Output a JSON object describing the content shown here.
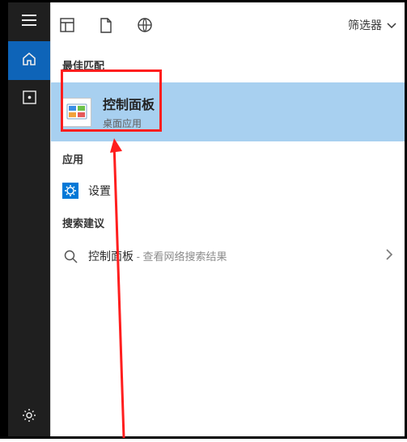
{
  "toolbar": {
    "filter_label": "筛选器"
  },
  "sections": {
    "best_header": "最佳匹配",
    "apps_header": "应用",
    "suggest_header": "搜索建议"
  },
  "best_match": {
    "title": "控制面板",
    "subtitle": "桌面应用"
  },
  "apps": {
    "settings_label": "设置"
  },
  "suggestions": {
    "prefix": "控制面板",
    "suffix": " - 查看网络搜索结果"
  },
  "icons": {
    "hamburger": "hamburger",
    "home": "home",
    "time": "time",
    "gear": "gear",
    "dashboard": "dashboard",
    "document": "document",
    "globe": "globe",
    "chevron_down": "chevron-down",
    "chevron_right": "chevron-right",
    "search": "search"
  }
}
